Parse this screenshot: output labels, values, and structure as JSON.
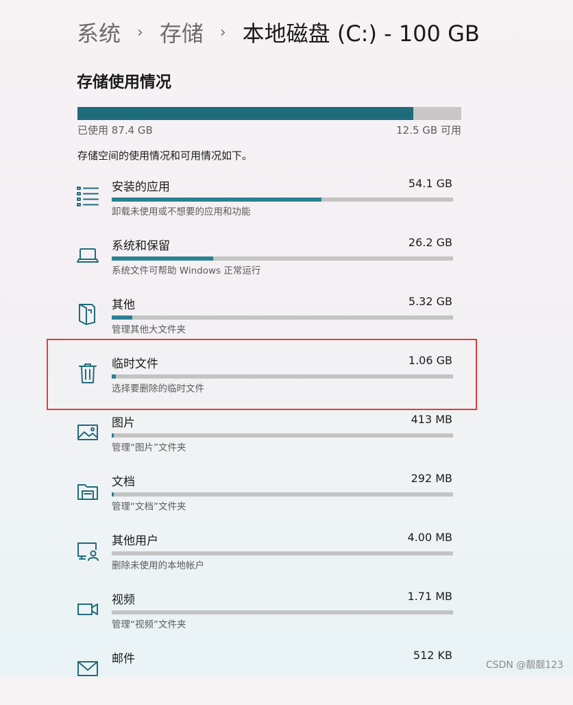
{
  "breadcrumb": {
    "items": [
      "系统",
      "存储"
    ],
    "separator": "›",
    "current": "本地磁盘 (C:) - 100 GB"
  },
  "section_title": "存储使用情况",
  "total": {
    "used_label": "已使用 87.4 GB",
    "free_label": "12.5 GB 可用",
    "used_fraction": 0.8748
  },
  "description": "存储空间的使用情况和可用情况如下。",
  "categories": [
    {
      "name": "安装的应用",
      "size": "54.1 GB",
      "subtitle": "卸载未使用或不想要的应用和功能",
      "fraction": 0.6145,
      "icon": "apps-list-icon"
    },
    {
      "name": "系统和保留",
      "size": "26.2 GB",
      "subtitle": "系统文件可帮助 Windows 正常运行",
      "fraction": 0.2976,
      "icon": "laptop-icon"
    },
    {
      "name": "其他",
      "size": "5.32 GB",
      "subtitle": "管理其他大文件夹",
      "fraction": 0.0604,
      "icon": "document-icon"
    },
    {
      "name": "临时文件",
      "size": "1.06 GB",
      "subtitle": "选择要删除的临时文件",
      "fraction": 0.012,
      "icon": "trash-icon"
    },
    {
      "name": "图片",
      "size": "413 MB",
      "subtitle": "管理“图片”文件夹",
      "fraction": 0.0046,
      "icon": "pictures-icon"
    },
    {
      "name": "文档",
      "size": "292 MB",
      "subtitle": "管理“文档”文件夹",
      "fraction": 0.0032,
      "icon": "documents-folder-icon"
    },
    {
      "name": "其他用户",
      "size": "4.00 MB",
      "subtitle": "删除未使用的本地帐户",
      "fraction": 0.0,
      "icon": "other-users-icon"
    },
    {
      "name": "视频",
      "size": "1.71 MB",
      "subtitle": "管理“视频”文件夹",
      "fraction": 0.0,
      "icon": "video-icon"
    },
    {
      "name": "邮件",
      "size": "512 KB",
      "subtitle": "",
      "fraction": 0.0,
      "icon": "mail-icon"
    }
  ],
  "watermark": "CSDN @靓靓123",
  "colors": {
    "accent": "#1e6b7b",
    "bar_track": "#c3c3c3",
    "highlight_border": "#e53b3b"
  }
}
